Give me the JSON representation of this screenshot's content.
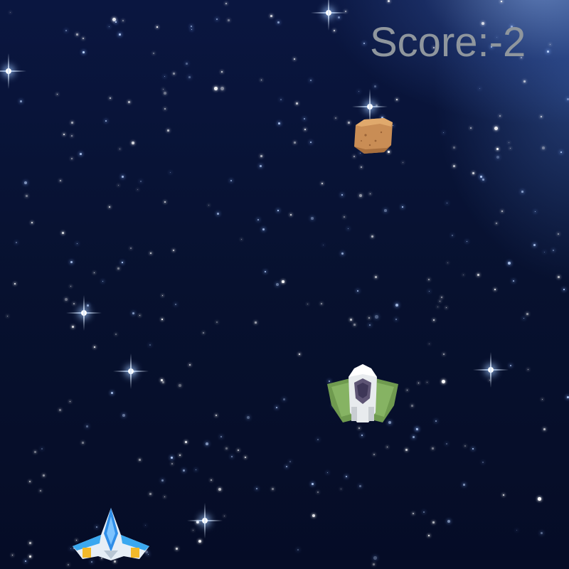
{
  "hud": {
    "score_text": "Score:-2"
  },
  "sprites": {
    "player": "player-spaceship-icon",
    "enemy": "enemy-spaceship-icon",
    "asteroid": "asteroid-icon"
  },
  "colors": {
    "background": "#07112f",
    "score": "#8f969d",
    "asteroid": "#c98d55",
    "enemy_wing": "#6f9a4f",
    "player_accent": "#2f8ee8"
  }
}
